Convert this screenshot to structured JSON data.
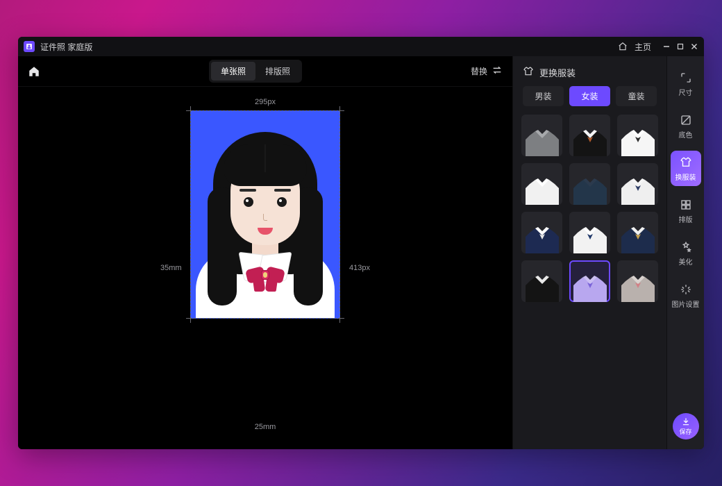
{
  "titlebar": {
    "app_name": "证件照 家庭版",
    "home_label": "主页"
  },
  "toolbar": {
    "segmented": {
      "single": "单张照",
      "layout": "排版照"
    },
    "replace_label": "替换"
  },
  "canvas": {
    "width_px": "295px",
    "height_px": "413px",
    "width_mm": "25mm",
    "height_mm": "35mm"
  },
  "panel": {
    "title": "更换服装",
    "tabs": {
      "male": "男装",
      "female": "女装",
      "child": "童装"
    }
  },
  "rail": {
    "size": "尺寸",
    "bg": "底色",
    "clothes": "换服装",
    "layout": "排版",
    "beautify": "美化",
    "image_settings": "图片设置",
    "save": "保存"
  },
  "outfits": [
    {
      "id": "grey-tee",
      "collar": "#a7a9ac",
      "body": "#7d7f82"
    },
    {
      "id": "black-bowtie",
      "collar": "#f4f4f4",
      "body": "#141414",
      "accent": "#b05a2a"
    },
    {
      "id": "white-ribbon",
      "collar": "#ffffff",
      "body": "#f6f6f6",
      "accent": "#2b2b2b"
    },
    {
      "id": "white-shirt",
      "collar": "#ffffff",
      "body": "#f1f1f1"
    },
    {
      "id": "navy-polo",
      "collar": "#2b3a4d",
      "body": "#23364a"
    },
    {
      "id": "bow-blouse",
      "collar": "#f5f5f5",
      "body": "#efefef",
      "accent": "#2f3e66"
    },
    {
      "id": "v-sweater",
      "collar": "#ffffff",
      "body": "#1d2a52",
      "accent": "#e7e7e7"
    },
    {
      "id": "sailor-white",
      "collar": "#ffffff",
      "body": "#f2f2f2",
      "accent": "#20386a"
    },
    {
      "id": "polo-navy",
      "collar": "#f1f1f1",
      "body": "#1d2c4c",
      "accent": "#c7a04a"
    },
    {
      "id": "black-suit",
      "collar": "#e9e9e9",
      "body": "#141414"
    },
    {
      "id": "lilac-bow",
      "collar": "#cbbef2",
      "body": "#b8a7ef",
      "accent": "#7b63d8",
      "selected": true
    },
    {
      "id": "sailor-grey",
      "collar": "#d9d2cf",
      "body": "#b9b1ad",
      "accent": "#d28086"
    }
  ]
}
